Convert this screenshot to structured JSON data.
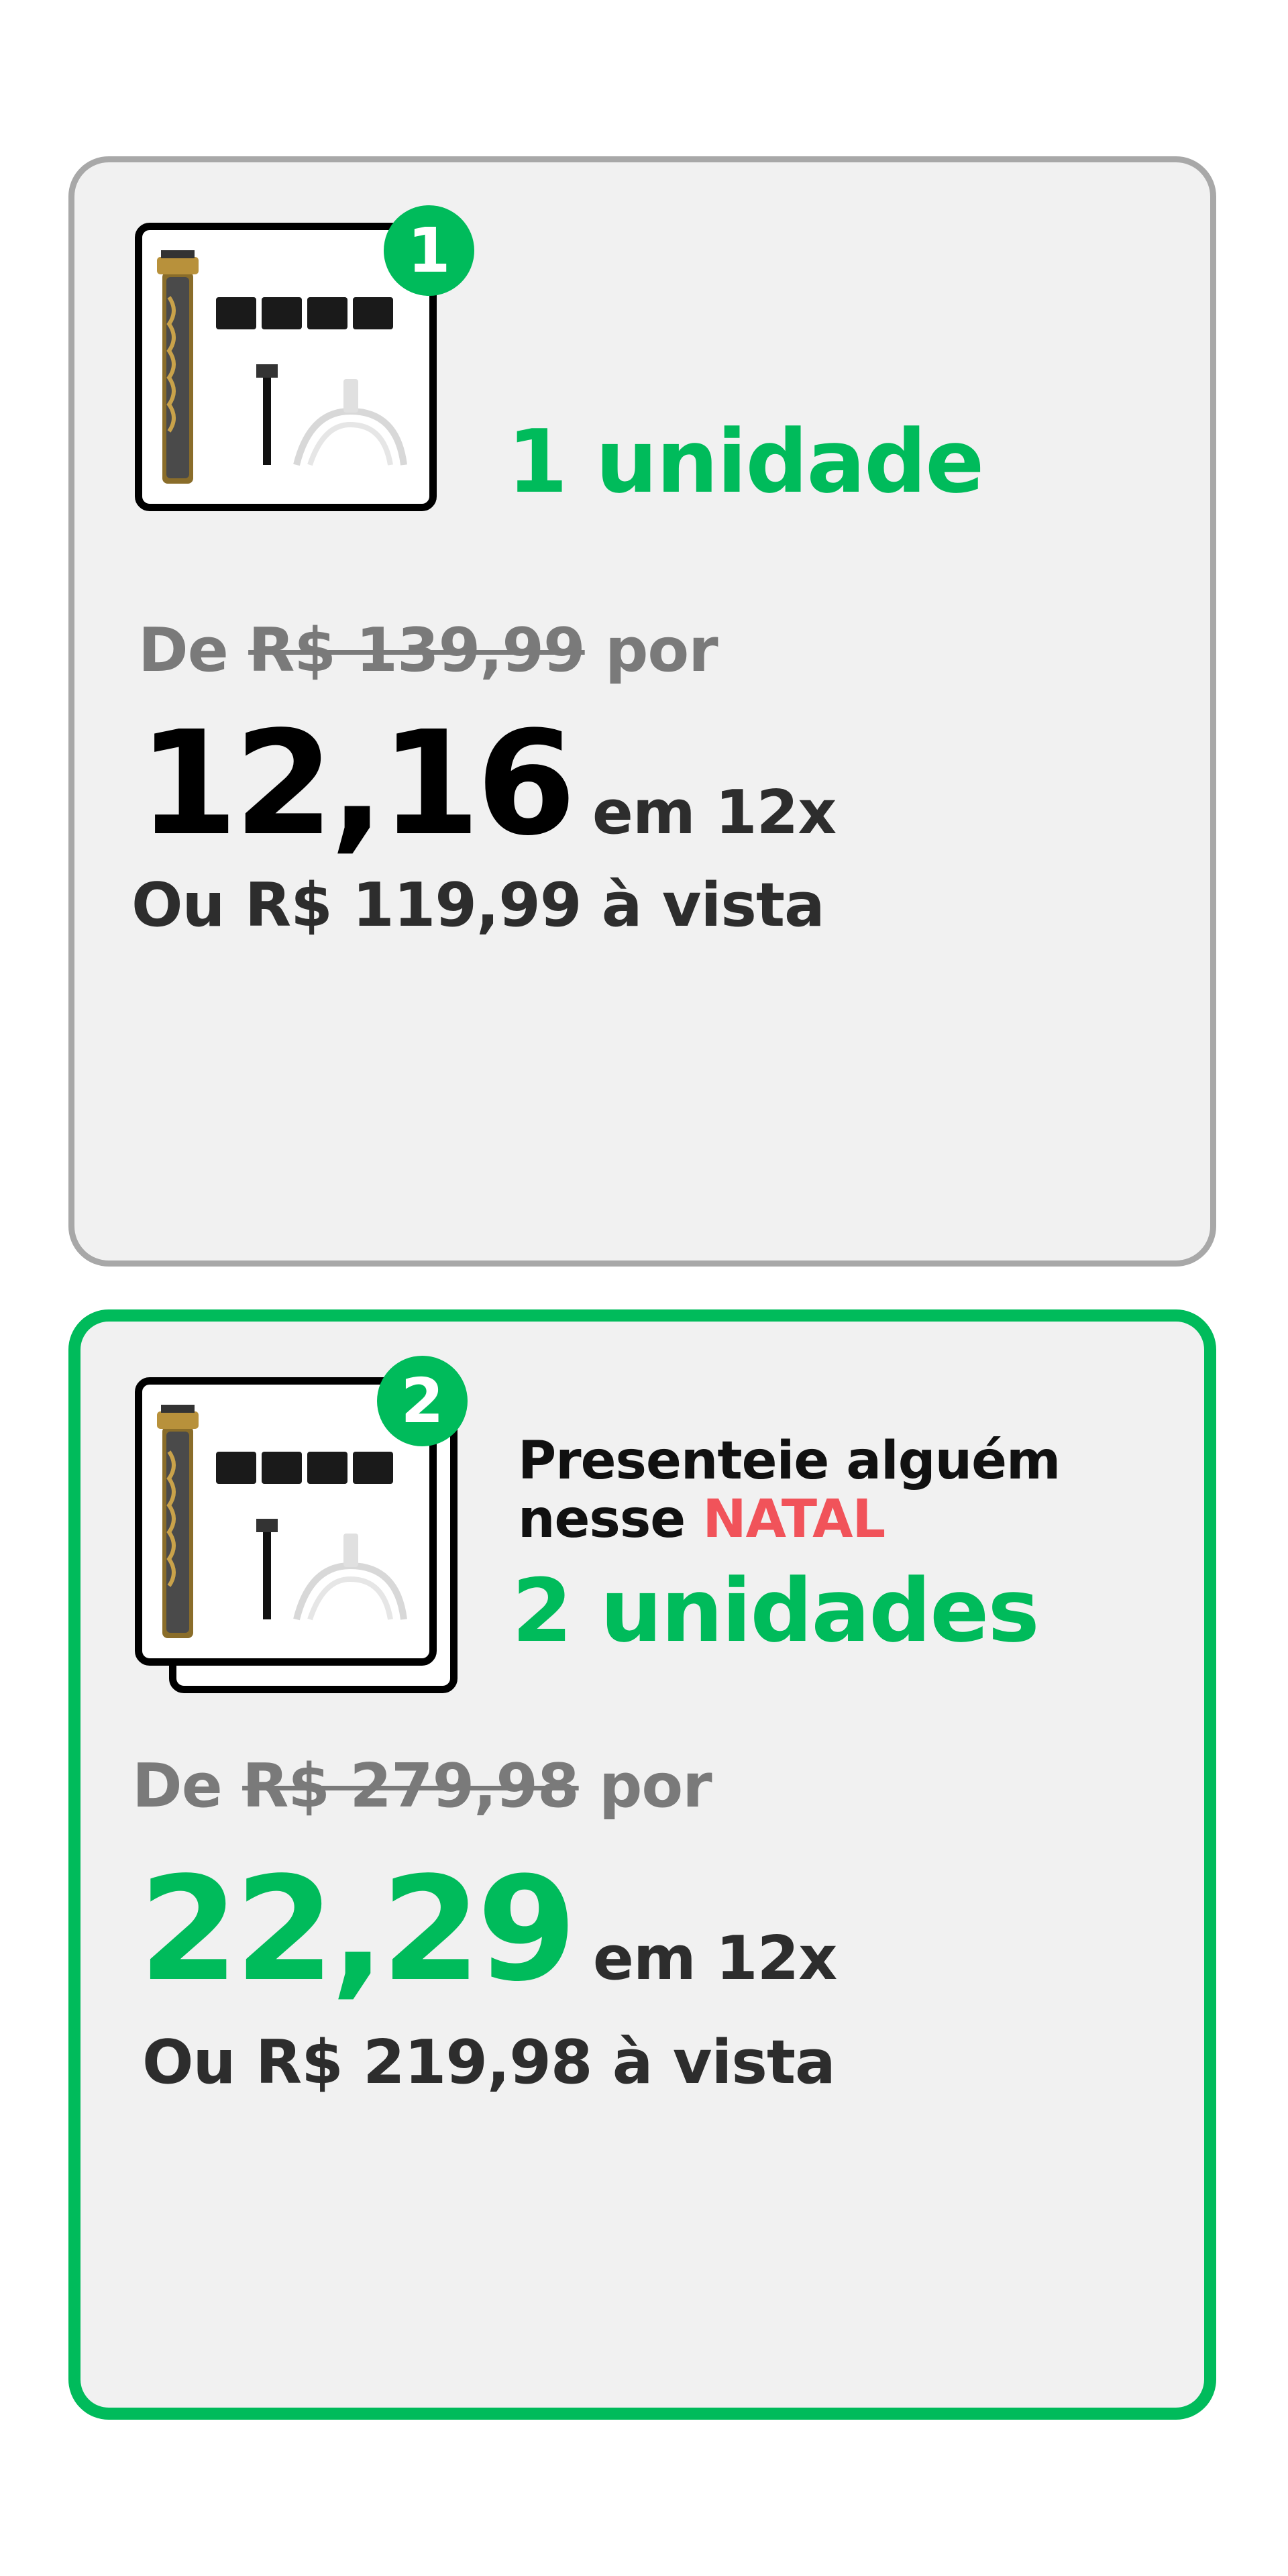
{
  "offers": [
    {
      "badge": "1",
      "quantity_label": "1 unidade",
      "from_prefix": "De",
      "original_price": "R$ 139,99",
      "from_suffix": "por",
      "installment_value": "12,16",
      "installment_label": "em 12x",
      "cash_price": "Ou R$ 119,99 à vista"
    },
    {
      "badge": "2",
      "promo_line1": "Presenteie alguém",
      "promo_line2_prefix": "nesse",
      "promo_highlight": "NATAL",
      "quantity_label": "2 unidades",
      "from_prefix": "De",
      "original_price": "R$ 279,98",
      "from_suffix": "por",
      "installment_value": "22,29",
      "installment_label": "em 12x",
      "cash_price": "Ou R$ 219,98 à vista",
      "selected": true
    }
  ],
  "colors": {
    "accent": "#00bb5b",
    "highlight": "#f1535a",
    "card_bg": "#f1f1f1",
    "border_unselected": "#a8a8a8",
    "text_muted": "#7a7a7a",
    "text_dark": "#2d2d2d"
  }
}
